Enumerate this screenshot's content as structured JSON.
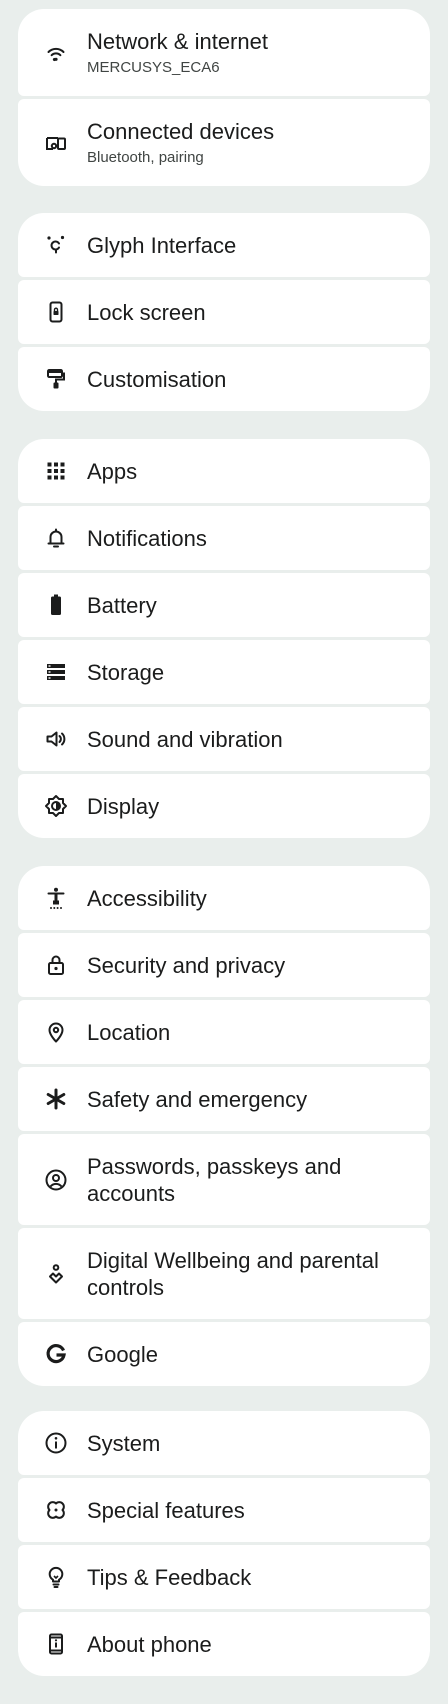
{
  "groups": [
    {
      "items": [
        {
          "label": "Network & internet",
          "subtitle": "MERCUSYS_ECA6",
          "icon": "wifi-icon"
        },
        {
          "label": "Connected devices",
          "subtitle": "Bluetooth, pairing",
          "icon": "devices-icon"
        }
      ]
    },
    {
      "items": [
        {
          "label": "Glyph Interface",
          "icon": "glyph-icon"
        },
        {
          "label": "Lock screen",
          "icon": "lock-screen-icon"
        },
        {
          "label": "Customisation",
          "icon": "paint-roller-icon"
        }
      ]
    },
    {
      "items": [
        {
          "label": "Apps",
          "icon": "apps-grid-icon"
        },
        {
          "label": "Notifications",
          "icon": "bell-icon"
        },
        {
          "label": "Battery",
          "icon": "battery-icon"
        },
        {
          "label": "Storage",
          "icon": "storage-icon"
        },
        {
          "label": "Sound and vibration",
          "icon": "speaker-icon"
        },
        {
          "label": "Display",
          "icon": "brightness-icon"
        }
      ]
    },
    {
      "items": [
        {
          "label": "Accessibility",
          "icon": "accessibility-icon"
        },
        {
          "label": "Security and privacy",
          "icon": "padlock-icon"
        },
        {
          "label": "Location",
          "icon": "location-pin-icon"
        },
        {
          "label": "Safety and emergency",
          "icon": "asterisk-icon"
        },
        {
          "label": "Passwords, passkeys and accounts",
          "icon": "account-circle-icon"
        },
        {
          "label": "Digital Wellbeing and parental controls",
          "icon": "wellbeing-icon"
        },
        {
          "label": "Google",
          "icon": "google-icon"
        }
      ]
    },
    {
      "items": [
        {
          "label": "System",
          "icon": "info-icon"
        },
        {
          "label": "Special features",
          "icon": "special-features-icon"
        },
        {
          "label": "Tips & Feedback",
          "icon": "lightbulb-icon"
        },
        {
          "label": "About phone",
          "icon": "phone-info-icon"
        }
      ]
    }
  ]
}
